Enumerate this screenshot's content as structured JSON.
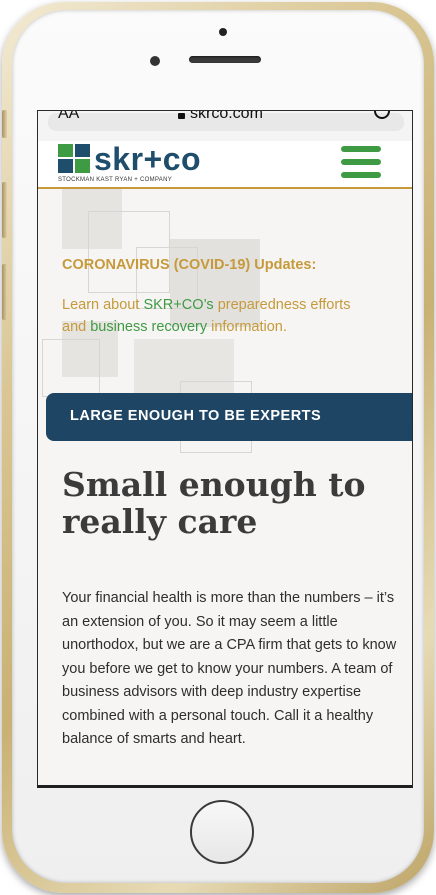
{
  "browser": {
    "text_size_label": "AA",
    "url": "skrco.com"
  },
  "header": {
    "logo_name": "skr+co",
    "logo_tagline": "STOCKMAN KAST RYAN + COMPANY",
    "menu_icon": "hamburger-menu-icon"
  },
  "covid": {
    "title": "CORONAVIRUS (COVID-19) Updates:",
    "text_part1": " Learn about ",
    "text_part2": "SKR+CO’s",
    "text_part3": " preparedness ",
    "text_part4": "efforts",
    "text_part5": "and ",
    "text_part6": "business recovery",
    "text_part7": " information."
  },
  "banner": {
    "label": "LARGE ENOUGH TO BE EXPERTS"
  },
  "main": {
    "headline": "Small enough to really care",
    "body": "Your financial health is more than the numbers – it’s an extension of you. So it may seem a little unorthodox, but we are a CPA firm that gets to know you before we get to know your numbers. A team of business advisors with deep industry expertise combined with a personal touch. Call it a healthy balance of smarts and heart."
  },
  "colors": {
    "brand_blue": "#1f4d6c",
    "brand_green": "#3f9a44",
    "brand_gold": "#c69a3b",
    "banner_bg": "#1f4565"
  }
}
